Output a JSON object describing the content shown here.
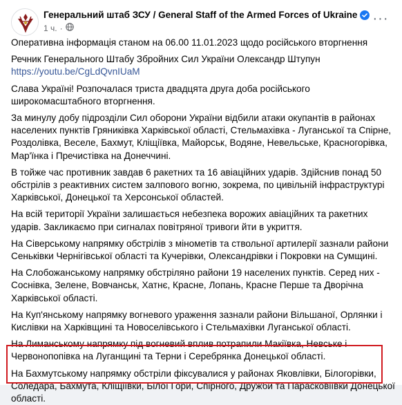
{
  "post": {
    "page_name": "Генеральний штаб ЗСУ / General Staff of the Armed Forces of Ukraine",
    "time": "1 ч.",
    "more_label": "···",
    "paragraphs": [
      "Оперативна інформація станом на 06.00 11.01.2023 щодо російського вторгнення",
      "Речник Генерального Штабу Збройних Сил України Олександр Штупун",
      "Слава Україні! Розпочалася триста двадцята друга доба російського широкомасштабного вторгнення.",
      "За минулу добу підрозділи Сил оборони України відбили атаки окупантів в районах населених пунктів Гряниківка Харківської області, Стельмахівка - Луганської та Спірне, Роздолівка, Веселе, Бахмут, Кліщіївка, Майорськ, Водяне, Невельське, Красногорівка, Мар'їнка і Пречистівка на Донеччині.",
      "В тойже час противник завдав 6 ракетних та 16 авіаційних ударів. Здійснив понад 50 обстрілів з реактивних систем залпового вогню, зокрема, по цивільній інфраструктурі Харківської, Донецької та Херсонської областей.",
      "На всій території України залишається небезпека ворожих авіаційних та ракетних ударів. Закликаємо при сигналах повітряної тривоги йти в укриття.",
      "На Сіверському напрямку обстрілів з мінометів та ствольної артилерії зазнали райони Сеньківки Чернігівської області та Кучерівки, Олександрівки і Покровки на Сумщині.",
      "На Слобожанському напрямку обстріляно райони 19 населених пунктів. Серед них - Соснівка, Зелене, Вовчанськ, Хатнє, Красне, Лопань, Красне Перше та Дворічна Харківської області.",
      "На Куп'янському напрямку вогневого ураження зазнали райони Вільшаної, Орлянки і Кислівки на Харківщині та Новоселівського і Стельмахівки Луганської області.",
      "На Лиманському напрямку під вогневий вплив потрапили Макіївка, Невське і Червонопопівка на Луганщині та Терни і Серебрянка Донецької області.",
      "На Бахмутському напрямку обстріли фіксувалися у районах Яковлівки, Білогорівки, Соледара, Бахмута, Кліщіївки, Білої Гори, Спірного, Дружби та Парасковіївки Донецької області."
    ],
    "video_link": "https://youtu.be/CgLdQvnIUaM"
  },
  "colors": {
    "link": "#385898",
    "verified": "#1877f2",
    "highlight": "#d0191f"
  }
}
